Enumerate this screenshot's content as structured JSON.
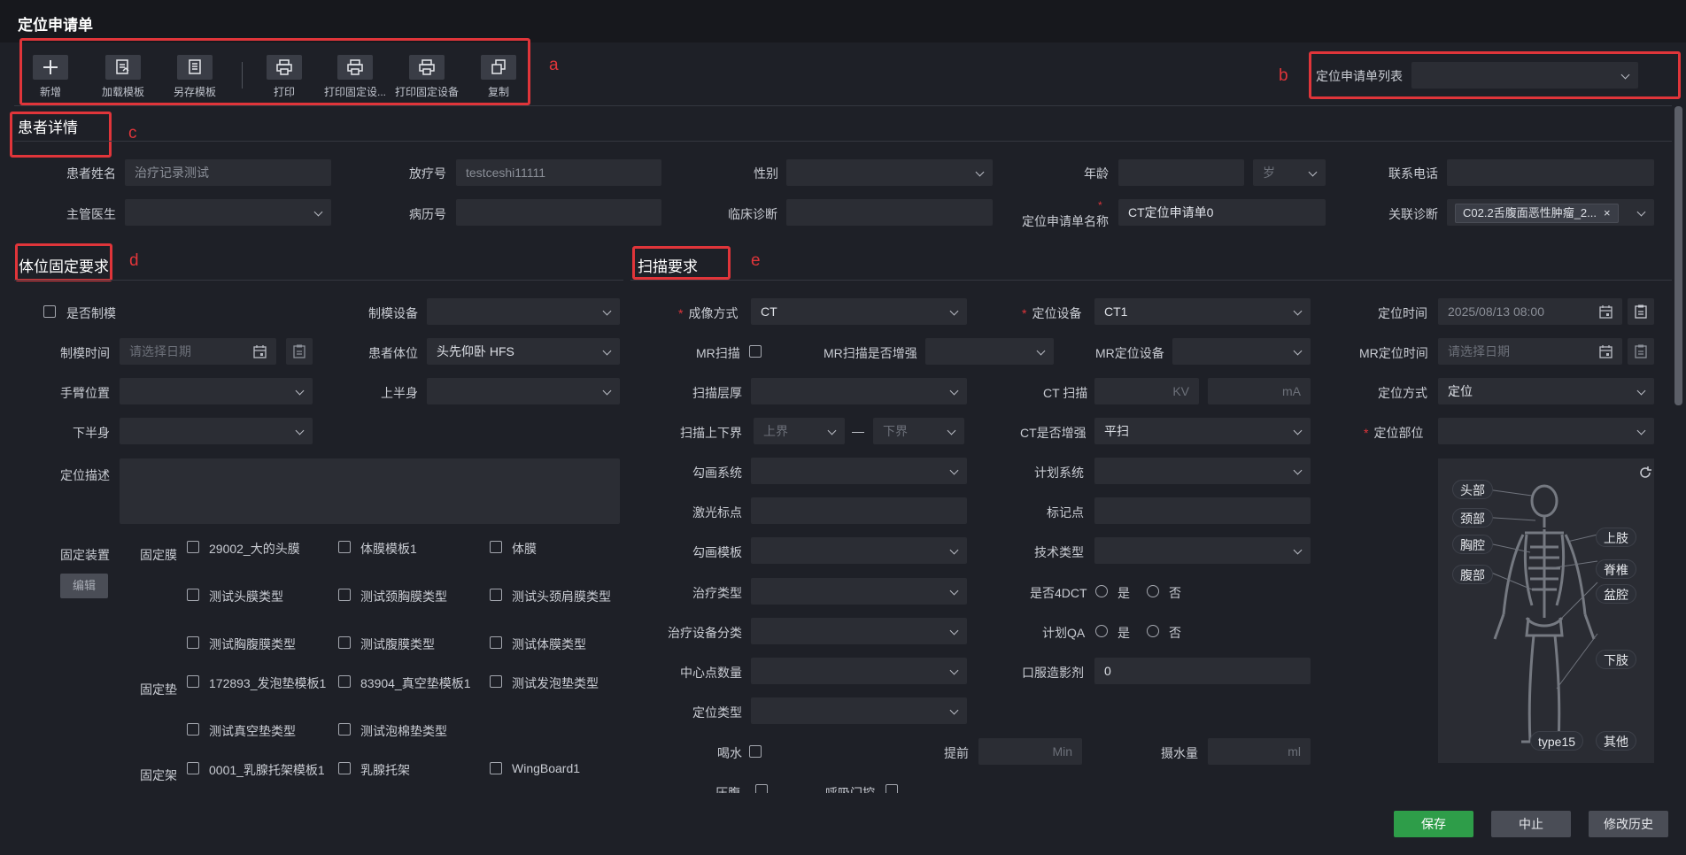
{
  "window": {
    "title": "定位申请单"
  },
  "annotations": {
    "a": "a",
    "b": "b",
    "c": "c",
    "d": "d",
    "e": "e"
  },
  "toolbar": {
    "add": "新增",
    "load_template": "加载模板",
    "save_template": "另存模板",
    "print": "打印",
    "print_fixed_dots": "打印固定设...",
    "print_fixed_device": "打印固定设备",
    "copy": "复制"
  },
  "request_list": {
    "label": "定位申请单列表",
    "value": ""
  },
  "patient": {
    "section_title": "患者详情",
    "name_label": "患者姓名",
    "name_value": "治疗记录测试",
    "rt_no_label": "放疗号",
    "rt_no_value": "testceshi11111",
    "gender_label": "性别",
    "gender_value": "",
    "age_label": "年龄",
    "age_value": "",
    "age_unit": "岁",
    "phone_label": "联系电话",
    "phone_value": "",
    "doctor_label": "主管医生",
    "doctor_value": "",
    "record_label": "病历号",
    "record_value": "",
    "diagnosis_label": "临床诊断",
    "diagnosis_value": "",
    "req_name_label": "定位申请单名称",
    "req_name_value": "CT定位申请单0",
    "linked_diag_label": "关联诊断",
    "linked_diag_value": "C02.2舌腹面恶性肿瘤_2...",
    "linked_diag_close": "×"
  },
  "fixation": {
    "section_title": "体位固定要求",
    "mold_label": "是否制模",
    "mold_device_label": "制模设备",
    "mold_device_value": "",
    "mold_time_label": "制模时间",
    "mold_time_placeholder": "请选择日期",
    "posture_label": "患者体位",
    "posture_value": "头先仰卧 HFS",
    "arm_label": "手臂位置",
    "arm_value": "",
    "upper_label": "上半身",
    "upper_value": "",
    "lower_label": "下半身",
    "lower_value": "",
    "desc_label": "定位描述",
    "desc_value": "",
    "device_label": "固定装置",
    "edit_btn": "编辑",
    "membrane_label": "固定膜",
    "cushion_label": "固定垫",
    "frame_label": "固定架",
    "membranes": [
      "29002_大的头膜",
      "体膜模板1",
      "体膜",
      "测试头膜类型",
      "测试颈胸膜类型",
      "测试头颈肩膜类型",
      "测试胸腹膜类型",
      "测试腹膜类型",
      "测试体膜类型"
    ],
    "cushions": [
      "172893_发泡垫模板1",
      "83904_真空垫模板1",
      "测试发泡垫类型",
      "测试真空垫类型",
      "测试泡棉垫类型"
    ],
    "frames": [
      "0001_乳腺托架模板1",
      "乳腺托架",
      "WingBoard1"
    ]
  },
  "scan": {
    "section_title": "扫描要求",
    "imaging_label": "成像方式",
    "imaging_value": "CT",
    "device_label": "定位设备",
    "device_value": "CT1",
    "time_label": "定位时间",
    "time_value": "2025/08/13 08:00",
    "mr_scan_label": "MR扫描",
    "mr_enhance_label": "MR扫描是否增强",
    "mr_enhance_value": "",
    "mr_device_label": "MR定位设备",
    "mr_device_value": "",
    "mr_time_label": "MR定位时间",
    "mr_time_placeholder": "请选择日期",
    "layer_label": "扫描层厚",
    "layer_value": "",
    "ct_scan_label": "CT 扫描",
    "kv_unit": "KV",
    "ma_unit": "mA",
    "method_label": "定位方式",
    "method_value": "定位",
    "bound_label": "扫描上下界",
    "upper_bound": "上界",
    "bound_dash": "—",
    "lower_bound": "下界",
    "ct_enhance_label": "CT是否增强",
    "ct_enhance_value": "平扫",
    "site_label": "定位部位",
    "site_value": "",
    "contour_sys_label": "勾画系统",
    "plan_sys_label": "计划系统",
    "laser_label": "激光标点",
    "mark_label": "标记点",
    "contour_tpl_label": "勾画模板",
    "tech_label": "技术类型",
    "treat_type_label": "治疗类型",
    "dct_label": "是否4DCT",
    "yes": "是",
    "no": "否",
    "treat_dev_label": "治疗设备分类",
    "qa_label": "计划QA",
    "center_label": "中心点数量",
    "oral_label": "口服造影剂",
    "oral_value": "0",
    "loc_type_label": "定位类型",
    "water_label": "喝水",
    "advance_label": "提前",
    "min_unit": "Min",
    "intake_label": "摄水量",
    "ml_unit": "ml",
    "press_label": "压腹",
    "breath_label": "呼吸门控"
  },
  "body_map": {
    "head": "头部",
    "neck": "颈部",
    "chest": "胸腔",
    "abdomen": "腹部",
    "upper_limb": "上肢",
    "spine": "脊椎",
    "pelvis": "盆腔",
    "lower_limb": "下肢",
    "type15": "type15",
    "other": "其他"
  },
  "footer": {
    "save": "保存",
    "stop": "中止",
    "history": "修改历史"
  },
  "colors": {
    "accent_red": "#e0353a",
    "save_green": "#2e9d49",
    "bg": "#1e2027"
  }
}
